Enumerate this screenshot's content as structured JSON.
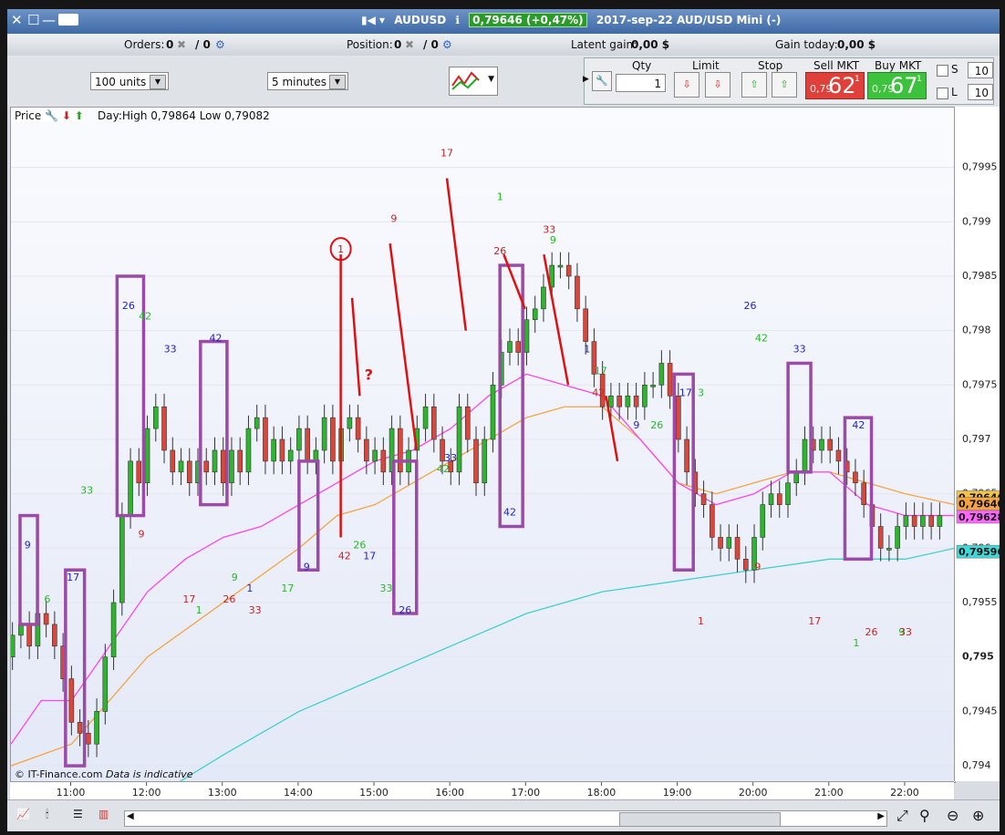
{
  "window": {
    "close_icon": "✕",
    "restore_icon": "☐",
    "minimize_icon": "—",
    "keyboard_icon": "keyboard-icon",
    "symbol": "AUDUSD",
    "price_badge": "0,79646 (+0,47%)",
    "description": "2017-sep-22 AUD/USD Mini (-)"
  },
  "status": {
    "orders_label": "Orders:",
    "orders_a": "0",
    "orders_b": "/ 0",
    "position_label": "Position:",
    "position_a": "0",
    "position_b": "/ 0",
    "latent_label": "Latent gain:",
    "latent_value": "0,00 $",
    "today_label": "Gain today:",
    "today_value": "0,00 $"
  },
  "toolbar": {
    "units": "100 units",
    "timeframe": "5 minutes"
  },
  "trade": {
    "qty_label": "Qty",
    "qty_value": "1",
    "limit_label": "Limit",
    "stop_label": "Stop",
    "sell_label": "Sell MKT",
    "sell_small": "0,79",
    "sell_big": "62",
    "sell_sup": "1",
    "buy_label": "Buy MKT",
    "buy_small": "0,79",
    "buy_big": "67",
    "buy_sup": "1",
    "s_label": "S",
    "s_value": "10",
    "l_label": "L",
    "l_value": "10"
  },
  "chart": {
    "price_label": "Price",
    "day_info": "Day:High 0,79864 Low 0,79082",
    "credit": "© IT-Finance.com",
    "credit_note": "Data is indicative",
    "annotation_q": "?",
    "annotation_circle": "1"
  },
  "chart_data": {
    "type": "candlestick",
    "symbol": "AUDUSD",
    "timeframe": "5 minutes",
    "ylim": [
      0.79385,
      0.80005
    ],
    "y_ticks": [
      "0,7995",
      "0,799",
      "0,7985",
      "0,798",
      "0,7975",
      "0,797",
      "0,7965",
      "0,796",
      "0,7955",
      "0,795",
      "0,7945",
      "0,794"
    ],
    "y_tick_values": [
      0.7995,
      0.799,
      0.7985,
      0.798,
      0.7975,
      0.797,
      0.7965,
      0.796,
      0.7955,
      0.795,
      0.7945,
      0.794
    ],
    "x_ticks": [
      "11:00",
      "12:00",
      "13:00",
      "14:00",
      "15:00",
      "16:00",
      "17:00",
      "18:00",
      "19:00",
      "20:00",
      "21:00",
      "22:00"
    ],
    "x_range_hours": [
      10.2,
      22.65
    ],
    "price_markers": [
      {
        "value": 0.79646,
        "label": "0,79646",
        "color": "#f5c242"
      },
      {
        "value": 0.7964,
        "label": "0,79640",
        "color": "#f5a442"
      },
      {
        "value": 0.79628,
        "label": "0,79628",
        "color": "#ff66ff"
      },
      {
        "value": 0.79596,
        "label": "0,79596",
        "color": "#40d8d8"
      }
    ],
    "candles_c": [
      0.7952,
      0.7953,
      0.7951,
      0.7954,
      0.7953,
      0.7951,
      0.7948,
      0.7944,
      0.7943,
      0.7942,
      0.7945,
      0.795,
      0.7955,
      0.7963,
      0.7968,
      0.7966,
      0.7971,
      0.7973,
      0.7969,
      0.7967,
      0.7968,
      0.7966,
      0.7968,
      0.7967,
      0.7969,
      0.7966,
      0.7969,
      0.7967,
      0.7971,
      0.7972,
      0.7968,
      0.797,
      0.7968,
      0.7969,
      0.7971,
      0.7968,
      0.7969,
      0.7972,
      0.7968,
      0.7971,
      0.7972,
      0.797,
      0.7968,
      0.7969,
      0.7967,
      0.7971,
      0.7967,
      0.7969,
      0.7971,
      0.7973,
      0.797,
      0.7968,
      0.7967,
      0.7973,
      0.797,
      0.7966,
      0.797,
      0.7975,
      0.7978,
      0.7979,
      0.7978,
      0.7981,
      0.7982,
      0.7984,
      0.7986,
      0.7986,
      0.7985,
      0.7982,
      0.7979,
      0.7976,
      0.7973,
      0.7974,
      0.7973,
      0.7974,
      0.7973,
      0.7975,
      0.7975,
      0.7977,
      0.7974,
      0.797,
      0.7967,
      0.7965,
      0.7964,
      0.7961,
      0.796,
      0.7961,
      0.7959,
      0.7958,
      0.7961,
      0.7964,
      0.7965,
      0.7964,
      0.7966,
      0.7967,
      0.797,
      0.7969,
      0.797,
      0.7969,
      0.7968,
      0.7967,
      0.7966,
      0.7964,
      0.7962,
      0.796,
      0.796,
      0.7962,
      0.7963,
      0.7962,
      0.7963,
      0.7962,
      0.7963
    ],
    "ma_magenta": [
      [
        10.2,
        0.7942
      ],
      [
        10.6,
        0.7946
      ],
      [
        11.0,
        0.7946
      ],
      [
        11.5,
        0.7951
      ],
      [
        12.0,
        0.7956
      ],
      [
        12.5,
        0.7959
      ],
      [
        13.0,
        0.7961
      ],
      [
        13.5,
        0.7962
      ],
      [
        14.0,
        0.7964
      ],
      [
        14.5,
        0.7966
      ],
      [
        15.0,
        0.7968
      ],
      [
        15.5,
        0.7969
      ],
      [
        16.0,
        0.7971
      ],
      [
        16.5,
        0.7974
      ],
      [
        17.0,
        0.7976
      ],
      [
        17.5,
        0.7975
      ],
      [
        18.0,
        0.7974
      ],
      [
        18.5,
        0.797
      ],
      [
        19.0,
        0.7966
      ],
      [
        19.5,
        0.7964
      ],
      [
        20.0,
        0.7965
      ],
      [
        20.5,
        0.7967
      ],
      [
        21.0,
        0.7967
      ],
      [
        21.5,
        0.7964
      ],
      [
        22.0,
        0.7963
      ],
      [
        22.65,
        0.7963
      ]
    ],
    "ma_orange": [
      [
        10.2,
        0.794
      ],
      [
        11.0,
        0.7942
      ],
      [
        12.0,
        0.795
      ],
      [
        13.0,
        0.7955
      ],
      [
        14.0,
        0.796
      ],
      [
        14.5,
        0.7963
      ],
      [
        15.0,
        0.7964
      ],
      [
        15.5,
        0.7966
      ],
      [
        16.0,
        0.7968
      ],
      [
        16.5,
        0.797
      ],
      [
        17.0,
        0.7972
      ],
      [
        17.5,
        0.7973
      ],
      [
        18.0,
        0.7973
      ],
      [
        18.5,
        0.797
      ],
      [
        19.0,
        0.7966
      ],
      [
        19.5,
        0.7965
      ],
      [
        20.0,
        0.7966
      ],
      [
        20.5,
        0.7967
      ],
      [
        21.0,
        0.7967
      ],
      [
        21.5,
        0.7966
      ],
      [
        22.0,
        0.7965
      ],
      [
        22.65,
        0.7964
      ]
    ],
    "ma_cyan": [
      [
        12.3,
        0.7938
      ],
      [
        13.0,
        0.7941
      ],
      [
        14.0,
        0.7945
      ],
      [
        15.0,
        0.7948
      ],
      [
        16.0,
        0.7951
      ],
      [
        17.0,
        0.7954
      ],
      [
        18.0,
        0.7956
      ],
      [
        19.0,
        0.7957
      ],
      [
        20.0,
        0.7958
      ],
      [
        21.0,
        0.7959
      ],
      [
        22.0,
        0.7959
      ],
      [
        22.65,
        0.796
      ]
    ],
    "boxes": [
      [
        10.32,
        10.55,
        0.7963,
        0.7953
      ],
      [
        10.92,
        11.17,
        0.7958,
        0.794
      ],
      [
        11.6,
        11.95,
        0.7985,
        0.7963
      ],
      [
        12.7,
        13.05,
        0.7979,
        0.7964
      ],
      [
        14.0,
        14.25,
        0.7968,
        0.7958
      ],
      [
        15.25,
        15.55,
        0.7968,
        0.7954
      ],
      [
        16.65,
        16.95,
        0.7986,
        0.7962
      ],
      [
        18.95,
        19.2,
        0.7976,
        0.7958
      ],
      [
        20.45,
        20.75,
        0.7977,
        0.7967
      ],
      [
        21.2,
        21.55,
        0.7972,
        0.7959
      ]
    ],
    "labels": [
      {
        "t": "9",
        "h": 10.42,
        "v": 0.796,
        "c": "#2222cc"
      },
      {
        "t": "6",
        "h": 10.68,
        "v": 0.7955,
        "c": "#22bb22"
      },
      {
        "t": "17",
        "h": 11.02,
        "v": 0.7957,
        "c": "#2222cc"
      },
      {
        "t": "33",
        "h": 11.2,
        "v": 0.7965,
        "c": "#22bb22"
      },
      {
        "t": "26",
        "h": 11.75,
        "v": 0.7982,
        "c": "#2222cc"
      },
      {
        "t": "42",
        "h": 11.97,
        "v": 0.7981,
        "c": "#22bb22"
      },
      {
        "t": "9",
        "h": 11.92,
        "v": 0.7961,
        "c": "#cc2222"
      },
      {
        "t": "33",
        "h": 12.3,
        "v": 0.7978,
        "c": "#2222cc"
      },
      {
        "t": "17",
        "h": 12.55,
        "v": 0.7955,
        "c": "#cc2222"
      },
      {
        "t": "1",
        "h": 12.68,
        "v": 0.7954,
        "c": "#22bb22"
      },
      {
        "t": "42",
        "h": 12.9,
        "v": 0.7979,
        "c": "#2222cc"
      },
      {
        "t": "26",
        "h": 13.08,
        "v": 0.7955,
        "c": "#cc2222"
      },
      {
        "t": "9",
        "h": 13.15,
        "v": 0.7957,
        "c": "#22bb22"
      },
      {
        "t": "1",
        "h": 13.35,
        "v": 0.7956,
        "c": "#2222cc"
      },
      {
        "t": "33",
        "h": 13.42,
        "v": 0.7954,
        "c": "#cc2222"
      },
      {
        "t": "17",
        "h": 13.85,
        "v": 0.7956,
        "c": "#22bb22"
      },
      {
        "t": "9",
        "h": 14.1,
        "v": 0.7958,
        "c": "#2222cc"
      },
      {
        "t": "42",
        "h": 14.6,
        "v": 0.7959,
        "c": "#cc2222"
      },
      {
        "t": "26",
        "h": 14.8,
        "v": 0.796,
        "c": "#22bb22"
      },
      {
        "t": "17",
        "h": 14.93,
        "v": 0.7959,
        "c": "#2222cc"
      },
      {
        "t": "9",
        "h": 15.25,
        "v": 0.799,
        "c": "#cc2222"
      },
      {
        "t": "33",
        "h": 15.15,
        "v": 0.7956,
        "c": "#22bb22"
      },
      {
        "t": "26",
        "h": 15.4,
        "v": 0.7954,
        "c": "#2222cc"
      },
      {
        "t": "42",
        "h": 15.9,
        "v": 0.7967,
        "c": "#22bb22"
      },
      {
        "t": "33",
        "h": 16.0,
        "v": 0.7968,
        "c": "#2222cc"
      },
      {
        "t": "17",
        "h": 15.95,
        "v": 0.7996,
        "c": "#cc2222"
      },
      {
        "t": "1",
        "h": 16.65,
        "v": 0.7992,
        "c": "#22bb22"
      },
      {
        "t": "26",
        "h": 16.65,
        "v": 0.7987,
        "c": "#cc2222"
      },
      {
        "t": "42",
        "h": 16.78,
        "v": 0.7963,
        "c": "#2222cc"
      },
      {
        "t": "33",
        "h": 17.3,
        "v": 0.7989,
        "c": "#cc2222"
      },
      {
        "t": "9",
        "h": 17.35,
        "v": 0.7988,
        "c": "#22bb22"
      },
      {
        "t": "1",
        "h": 17.8,
        "v": 0.7978,
        "c": "#2222cc"
      },
      {
        "t": "17",
        "h": 17.98,
        "v": 0.7976,
        "c": "#22bb22"
      },
      {
        "t": "42",
        "h": 17.95,
        "v": 0.7974,
        "c": "#cc2222"
      },
      {
        "t": "9",
        "h": 18.45,
        "v": 0.7971,
        "c": "#2222cc"
      },
      {
        "t": "26",
        "h": 18.72,
        "v": 0.7971,
        "c": "#22bb22"
      },
      {
        "t": "17",
        "h": 19.1,
        "v": 0.7974,
        "c": "#2222cc"
      },
      {
        "t": "3",
        "h": 19.3,
        "v": 0.7974,
        "c": "#22bb22"
      },
      {
        "t": "1",
        "h": 19.3,
        "v": 0.7953,
        "c": "#cc2222"
      },
      {
        "t": "9",
        "h": 20.05,
        "v": 0.7958,
        "c": "#cc2222"
      },
      {
        "t": "26",
        "h": 19.95,
        "v": 0.7982,
        "c": "#2222cc"
      },
      {
        "t": "42",
        "h": 20.1,
        "v": 0.7979,
        "c": "#22bb22"
      },
      {
        "t": "33",
        "h": 20.6,
        "v": 0.7978,
        "c": "#2222cc"
      },
      {
        "t": "17",
        "h": 20.8,
        "v": 0.7953,
        "c": "#cc2222"
      },
      {
        "t": "42",
        "h": 21.38,
        "v": 0.7971,
        "c": "#2222cc"
      },
      {
        "t": "1",
        "h": 21.35,
        "v": 0.7951,
        "c": "#22bb22"
      },
      {
        "t": "26",
        "h": 21.55,
        "v": 0.7952,
        "c": "#cc2222"
      },
      {
        "t": "9",
        "h": 21.95,
        "v": 0.7952,
        "c": "#22bb22"
      },
      {
        "t": "33",
        "h": 22.0,
        "v": 0.7952,
        "c": "#cc2222"
      }
    ],
    "red_lines": [
      [
        14.55,
        0.7987,
        14.55,
        0.7961
      ],
      [
        14.7,
        0.7983,
        14.8,
        0.7974
      ],
      [
        15.2,
        0.7988,
        15.55,
        0.7969
      ],
      [
        15.95,
        0.7994,
        16.2,
        0.798
      ],
      [
        16.7,
        0.7987,
        16.98,
        0.7982
      ],
      [
        17.23,
        0.7987,
        17.55,
        0.7975
      ],
      [
        18.05,
        0.7974,
        18.2,
        0.7968
      ]
    ]
  }
}
